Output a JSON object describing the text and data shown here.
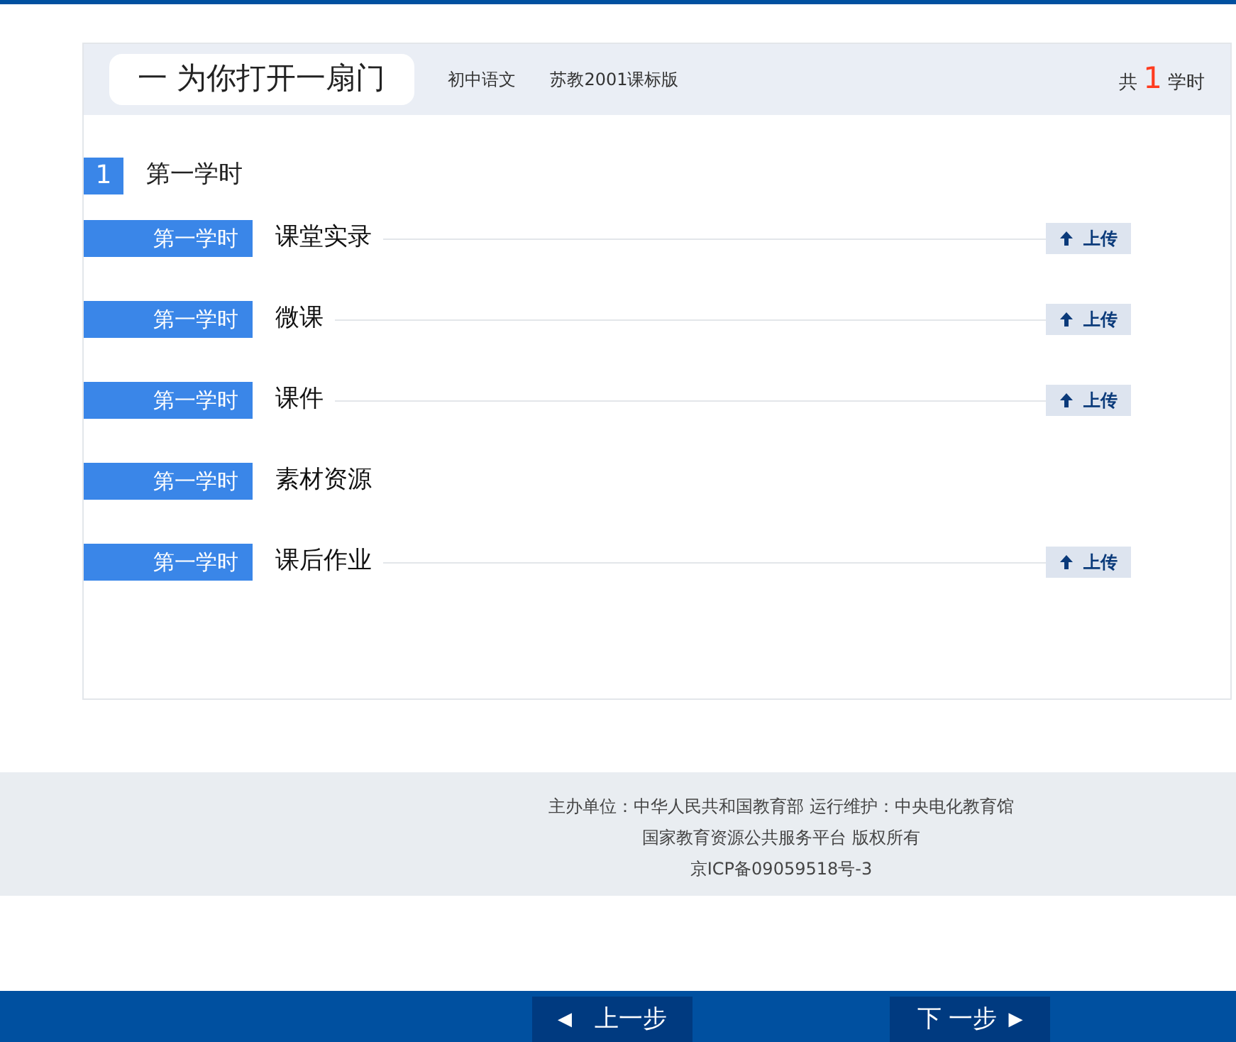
{
  "course": {
    "title": "一 为你打开一扇门",
    "subject": "初中语文",
    "edition": "苏教2001课标版",
    "total_prefix": "共",
    "total_count": "1",
    "total_suffix": "学时"
  },
  "lesson": {
    "number": "1",
    "title": "第一学时"
  },
  "resources": [
    {
      "tag": "第一学时",
      "name": "课堂实录",
      "upload": true,
      "upload_label": "上传"
    },
    {
      "tag": "第一学时",
      "name": "微课",
      "upload": true,
      "upload_label": "上传"
    },
    {
      "tag": "第一学时",
      "name": "课件",
      "upload": true,
      "upload_label": "上传"
    },
    {
      "tag": "第一学时",
      "name": "素材资源",
      "upload": false
    },
    {
      "tag": "第一学时",
      "name": "课后作业",
      "upload": true,
      "upload_label": "上传"
    }
  ],
  "footer": [
    "主办单位：中华人民共和国教育部 运行维护：中央电化教育馆",
    "国家教育资源公共服务平台 版权所有",
    "京ICP备09059518号-3"
  ],
  "nav": {
    "prev_icon": "◀",
    "prev": "上一步",
    "next": "下 一步",
    "next_icon": "▶"
  }
}
